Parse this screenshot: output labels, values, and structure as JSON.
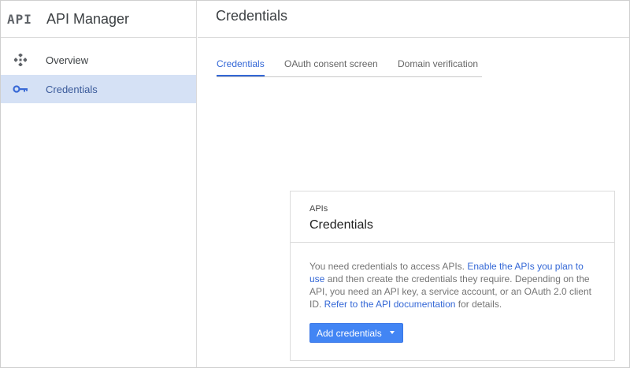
{
  "app": {
    "logo_text": "API",
    "title": "API Manager"
  },
  "sidebar": {
    "items": [
      {
        "label": "Overview",
        "icon": "overview-diamond-icon",
        "active": false
      },
      {
        "label": "Credentials",
        "icon": "key-icon",
        "active": true
      }
    ]
  },
  "main": {
    "title": "Credentials",
    "tabs": [
      {
        "label": "Credentials",
        "active": true
      },
      {
        "label": "OAuth consent screen",
        "active": false
      },
      {
        "label": "Domain verification",
        "active": false
      }
    ]
  },
  "card": {
    "eyebrow": "APIs",
    "title": "Credentials",
    "text_1": "You need credentials to access APIs. ",
    "link_1": "Enable the APIs you plan to use",
    "text_2": " and then create the credentials they require. Depending on the API, you need an API key, a service account, or an OAuth 2.0 client ID. ",
    "link_2": "Refer to the API documentation",
    "text_3": " for details.",
    "button_label": "Add credentials"
  },
  "colors": {
    "accent": "#3367d6",
    "button": "#4285f4",
    "active_nav_bg": "#d5e1f5"
  }
}
